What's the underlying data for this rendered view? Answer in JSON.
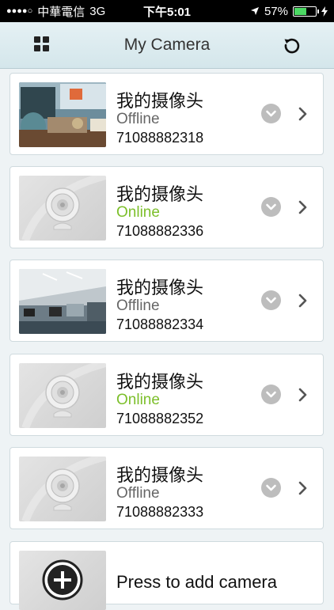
{
  "status_bar": {
    "carrier": "中華電信",
    "network": "3G",
    "time": "下午5:01",
    "battery": "57%",
    "battery_level": 0.57
  },
  "header": {
    "title": "My Camera"
  },
  "cameras": [
    {
      "name": "我的摄像头",
      "status": "Offline",
      "id": "71088882318",
      "thumbnail": "office-desk-photo",
      "status_color": "#666666"
    },
    {
      "name": "我的摄像头",
      "status": "Online",
      "id": "71088882336",
      "thumbnail": "camera-placeholder",
      "status_color": "#7cbf2a"
    },
    {
      "name": "我的摄像头",
      "status": "Offline",
      "id": "71088882334",
      "thumbnail": "office-room-photo",
      "status_color": "#666666"
    },
    {
      "name": "我的摄像头",
      "status": "Online",
      "id": "71088882352",
      "thumbnail": "camera-placeholder",
      "status_color": "#7cbf2a"
    },
    {
      "name": "我的摄像头",
      "status": "Offline",
      "id": "71088882333",
      "thumbnail": "camera-placeholder",
      "status_color": "#666666"
    }
  ],
  "add_camera": {
    "label": "Press to add camera"
  }
}
